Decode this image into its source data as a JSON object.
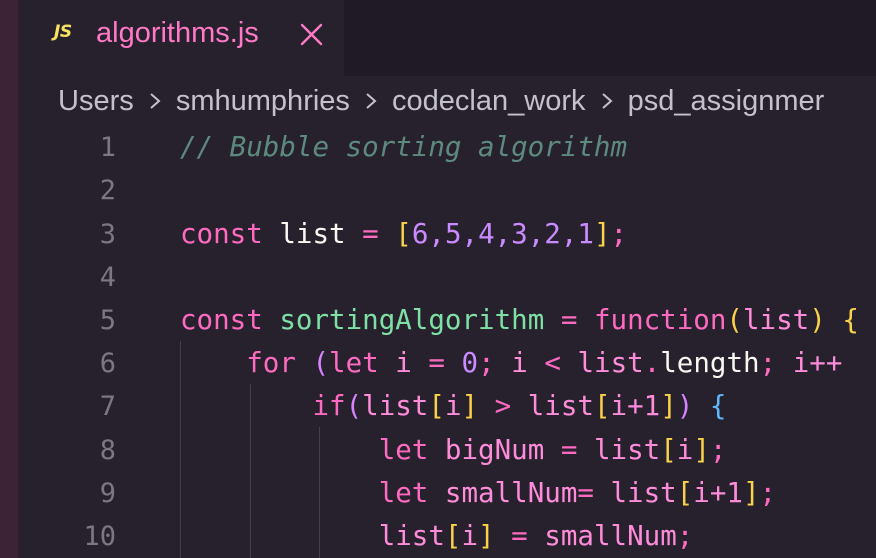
{
  "tab": {
    "label": "algorithms.js",
    "icon": "JS"
  },
  "breadcrumb": [
    "Users",
    "smhumphries",
    "codeclan_work",
    "psd_assignmer"
  ],
  "lines": [
    {
      "n": "1"
    },
    {
      "n": "2"
    },
    {
      "n": "3"
    },
    {
      "n": "4"
    },
    {
      "n": "5"
    },
    {
      "n": "6"
    },
    {
      "n": "7"
    },
    {
      "n": "8"
    },
    {
      "n": "9"
    },
    {
      "n": "10"
    }
  ],
  "code": {
    "l1_comment": "// Bubble sorting algorithm",
    "l3_const": "const",
    "l3_list": "list",
    "l3_eq": "=",
    "l3_open": "[",
    "l3_values": "6,5,4,3,2,1",
    "l3_close": "]",
    "l3_semi": ";",
    "l5_const": "const",
    "l5_name": "sortingAlgorithm",
    "l5_eq": "=",
    "l5_function": "function",
    "l5_open": "(",
    "l5_param": "list",
    "l5_close": ")",
    "l5_tail": " {",
    "l6_for": "for",
    "l6_open": "(",
    "l6_let": "let",
    "l6_i": "i",
    "l6_eq": "=",
    "l6_zero": "0",
    "l6_semi1": ";",
    "l6_i2": "i",
    "l6_lt": "<",
    "l6_list": "list",
    "l6_dot": ".",
    "l6_length": "length",
    "l6_semi2": ";",
    "l6_inc": "i++",
    "l7_if": "if",
    "l7_open": "(",
    "l7_list1": "list",
    "l7_b1o": "[",
    "l7_i1": "i",
    "l7_b1c": "]",
    "l7_gt": ">",
    "l7_list2": "list",
    "l7_b2o": "[",
    "l7_i2": "i+1",
    "l7_b2c": "]",
    "l7_close": ")",
    "l7_brace": "{",
    "l8_let": "let",
    "l8_name": "bigNum",
    "l8_eq": "=",
    "l8_list": "list",
    "l8_bo": "[",
    "l8_i": "i",
    "l8_bc": "]",
    "l8_semi": ";",
    "l9_let": "let",
    "l9_name": "smallNum",
    "l9_eq": "=",
    "l9_list": "list",
    "l9_bo": "[",
    "l9_i": "i+1",
    "l9_bc": "]",
    "l9_semi": ";",
    "l10_list": "list",
    "l10_bo": "[",
    "l10_i": "i",
    "l10_bc": "]",
    "l10_eq": "=",
    "l10_val": "smallNum",
    "l10_semi": ";"
  }
}
